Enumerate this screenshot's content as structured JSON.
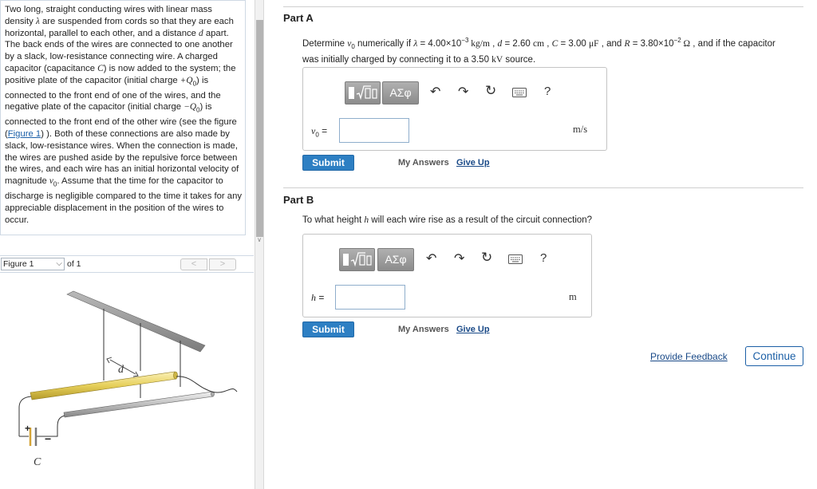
{
  "problem": {
    "p1": "Two long, straight conducting wires with linear mass density ",
    "lambda": "λ",
    "p2": " are suspended from cords so that they are each horizontal, parallel to each other, and a distance ",
    "d": "d",
    "p3": " apart. The back ends of the wires are connected to one another by a slack, low-resistance connecting wire. A charged capacitor (capacitance ",
    "C": "C",
    "p4": ") is now added to the system; the positive plate of the capacitor (initial charge ",
    "plusQ0": "+Q",
    "sub0a": "0",
    "p5": ") is connected to the front end of one of the wires, and the negative plate of the capacitor (initial charge ",
    "minusQ0": "−Q",
    "sub0b": "0",
    "p6": ") is connected to the front end of the other wire (see the figure (",
    "figure_link": "Figure 1",
    "p7": ") ). Both of these connections are also made by slack, low-resistance wires. When the connection is made, the wires are pushed aside by the repulsive force between the wires, and each wire has an initial horizontal velocity of magnitude ",
    "v": "v",
    "sub0c": "0",
    "p8": ". Assume that the time for the capacitor to discharge is negligible compared to the time it takes for any appreciable displacement in the position of the wires to occur."
  },
  "figure": {
    "select_value": "Figure 1",
    "of_label": "of 1",
    "prev": "<",
    "next": ">",
    "label_d": "d",
    "label_C": "C",
    "label_plus": "+",
    "label_minus": "−"
  },
  "partA": {
    "title": "Part A",
    "q1": "Determine ",
    "q_v0": "v",
    "q_v0_sub": "0",
    "q2": " numerically if ",
    "q_lambda": "λ",
    "q3": " = 4.00×10",
    "q_exp1": "−3",
    "q_unit1": " kg/m",
    "q4": " , ",
    "q_d": "d",
    "q5": " = 2.60 ",
    "q_cm": "cm",
    "q6": " , ",
    "q_C": "C",
    "q7": " = 3.00 ",
    "q_uF": "μF",
    "q8": " , and ",
    "q_R": "R",
    "q9": " = 3.80×10",
    "q_exp2": "−2",
    "q_ohm": " Ω",
    "q10": " , and if the capacitor was initially charged by connecting it to a 3.50 ",
    "q_kV": "kV",
    "q11": " source.",
    "var_label": "v",
    "var_sub": "0",
    "var_eq": " =",
    "unit": "m/s",
    "submit": "Submit",
    "my_answers": "My Answers",
    "give_up": "Give Up"
  },
  "partB": {
    "title": "Part B",
    "q1": "To what height ",
    "q_h": "h",
    "q2": " will each wire rise as a result of the circuit connection?",
    "var_label": "h",
    "var_eq": " =",
    "unit": "m",
    "submit": "Submit",
    "my_answers": "My Answers",
    "give_up": "Give Up"
  },
  "toolbar": {
    "greek": "ΑΣφ",
    "help": "?"
  },
  "footer": {
    "provide_feedback": "Provide Feedback",
    "continue": "Continue"
  },
  "colors": {
    "accent_blue": "#2d7fc3",
    "link_blue": "#1a4a88",
    "wire_yellow": "#e8d46a",
    "wire_gray": "#bdbdbd"
  }
}
